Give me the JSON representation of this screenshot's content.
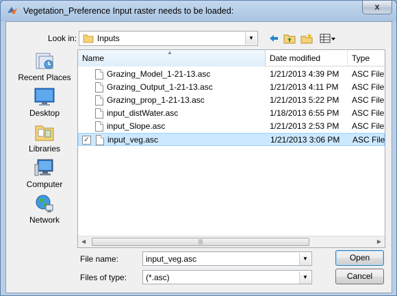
{
  "window": {
    "title": "Vegetation_Preference Input raster needs to be loaded:",
    "close_label": "x"
  },
  "lookin": {
    "label": "Look in:",
    "value": "Inputs"
  },
  "toolbar": {
    "back_icon": "back-arrow-icon",
    "up_icon": "up-folder-icon",
    "new_folder_icon": "new-folder-icon",
    "view_menu_icon": "view-menu-icon"
  },
  "places": [
    {
      "label": "Recent Places",
      "icon": "recent-places-icon"
    },
    {
      "label": "Desktop",
      "icon": "desktop-icon"
    },
    {
      "label": "Libraries",
      "icon": "libraries-icon"
    },
    {
      "label": "Computer",
      "icon": "computer-icon"
    },
    {
      "label": "Network",
      "icon": "network-icon"
    }
  ],
  "columns": {
    "name": "Name",
    "date": "Date modified",
    "type": "Type"
  },
  "files": [
    {
      "name": "Grazing_Model_1-21-13.asc",
      "date": "1/21/2013 4:39 PM",
      "type": "ASC File",
      "selected": false
    },
    {
      "name": "Grazing_Output_1-21-13.asc",
      "date": "1/21/2013 4:11 PM",
      "type": "ASC File",
      "selected": false
    },
    {
      "name": "Grazing_prop_1-21-13.asc",
      "date": "1/21/2013 5:22 PM",
      "type": "ASC File",
      "selected": false
    },
    {
      "name": "input_distWater.asc",
      "date": "1/18/2013 6:55 PM",
      "type": "ASC File",
      "selected": false
    },
    {
      "name": "input_Slope.asc",
      "date": "1/21/2013 2:53 PM",
      "type": "ASC File",
      "selected": false
    },
    {
      "name": "input_veg.asc",
      "date": "1/21/2013 3:06 PM",
      "type": "ASC File",
      "selected": true
    }
  ],
  "filename": {
    "label": "File name:",
    "value": "input_veg.asc"
  },
  "filetype": {
    "label": "Files of type:",
    "value": "(*.asc)"
  },
  "buttons": {
    "open": "Open",
    "cancel": "Cancel"
  }
}
